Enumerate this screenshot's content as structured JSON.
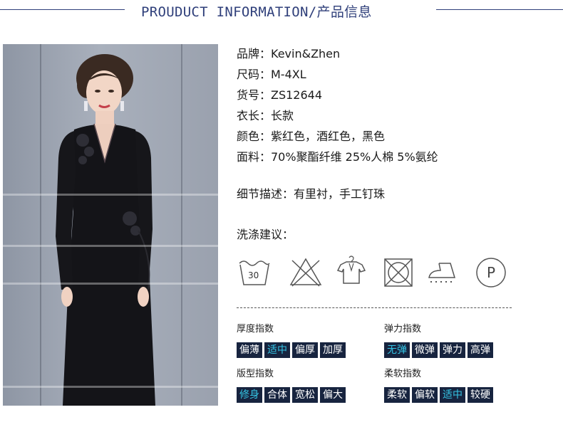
{
  "header": {
    "title": "PROUDUCT INFORMATION/产品信息"
  },
  "info": [
    "品牌：Kevin&Zhen",
    "尺码：M-4XL",
    "货号：ZS12644",
    "衣长：长款",
    "颜色：紫红色，酒红色，黑色",
    "面料：70%聚酯纤维 25%人棉 5%氨纶"
  ],
  "detail": "细节描述：有里衬，手工钉珠",
  "wash": {
    "label": "洗涤建议：",
    "temp": "30",
    "icons": [
      "wash-30-icon",
      "no-bleach-icon",
      "hang-dry-icon",
      "no-tumble-dry-icon",
      "iron-icon",
      "dry-clean-p-icon"
    ]
  },
  "indices": {
    "thickness": {
      "label": "厚度指数",
      "options": [
        "偏薄",
        "适中",
        "偏厚",
        "加厚"
      ],
      "selected": 1
    },
    "elasticity": {
      "label": "弹力指数",
      "options": [
        "无弹",
        "微弹",
        "弹力",
        "高弹"
      ],
      "selected": 0
    },
    "fit": {
      "label": "版型指数",
      "options": [
        "修身",
        "合体",
        "宽松",
        "偏大"
      ],
      "selected": 0
    },
    "softness": {
      "label": "柔软指数",
      "options": [
        "柔软",
        "偏软",
        "适中",
        "较硬"
      ],
      "selected": 2
    }
  },
  "colors": {
    "accent": "#2f3f7a",
    "option_bg": "#17243f",
    "option_text": "#ffffff",
    "option_selected": "#35c4e4"
  }
}
